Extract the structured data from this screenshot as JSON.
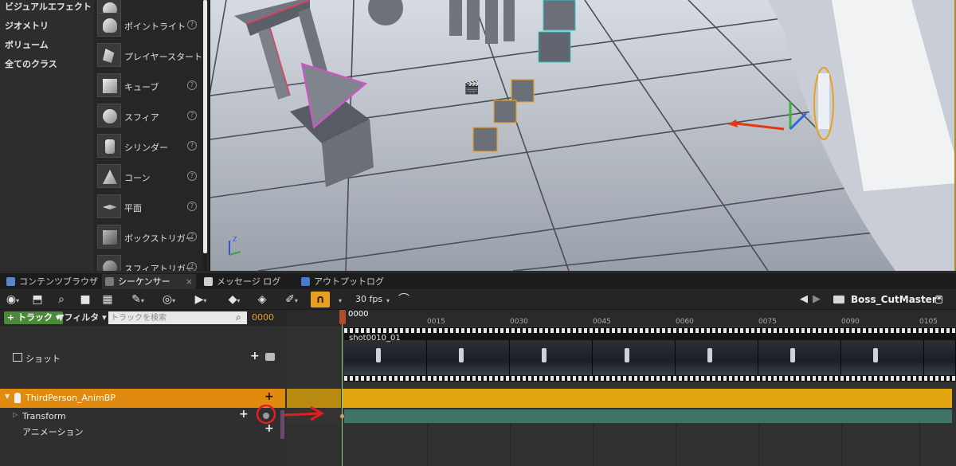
{
  "categories": {
    "items": [
      {
        "label": "ビジュアルエフェクト"
      },
      {
        "label": "ジオメトリ"
      },
      {
        "label": "ボリューム"
      },
      {
        "label": "全てのクラス"
      }
    ]
  },
  "actors": {
    "items": [
      {
        "label": "ポイントライト",
        "icon": "point-light-icon"
      },
      {
        "label": "プレイヤースタート",
        "icon": "player-start-icon"
      },
      {
        "label": "キューブ",
        "icon": "cube-icon"
      },
      {
        "label": "スフィア",
        "icon": "sphere-icon"
      },
      {
        "label": "シリンダー",
        "icon": "cylinder-icon"
      },
      {
        "label": "コーン",
        "icon": "cone-icon"
      },
      {
        "label": "平面",
        "icon": "plane-icon"
      },
      {
        "label": "ボックストリガー",
        "icon": "box-trigger-icon"
      },
      {
        "label": "スフィアトリガー",
        "icon": "sphere-trigger-icon"
      }
    ],
    "help_glyph": "?"
  },
  "tabs": [
    {
      "label": "コンテンツブラウザ",
      "icon": "content-browser-icon",
      "active": false
    },
    {
      "label": "シーケンサー",
      "icon": "sequencer-icon",
      "active": true
    },
    {
      "label": "メッセージ ログ",
      "icon": "message-log-icon",
      "active": false
    },
    {
      "label": "アウトプットログ",
      "icon": "output-log-icon",
      "active": false
    }
  ],
  "tab_close_glyph": "×",
  "toolbar": {
    "fps": "30 fps",
    "sequence_name": "Boss_CutMaster*"
  },
  "tracks": {
    "add_track_label": "+ トラック ▾",
    "filter_label": "▼フィルタ ▾",
    "search_placeholder": "トラックを検索",
    "current_frame": "0000",
    "shot_label": "ショット",
    "anim_bp_label": "ThirdPerson_AnimBP",
    "transform_label": "Transform",
    "animation_label": "アニメーション"
  },
  "timeline": {
    "playhead_frame": "0000",
    "ticks": [
      "0015",
      "0030",
      "0045",
      "0060",
      "0075",
      "0090",
      "0105"
    ],
    "shot_name": "shot0010_01"
  },
  "colors": {
    "accent_orange": "#e08a10",
    "track_bar_gold": "#e2a70f",
    "transform_bar_teal": "#3f7468",
    "add_track_green": "#4b8a3a",
    "annotation_red": "#e02020"
  }
}
